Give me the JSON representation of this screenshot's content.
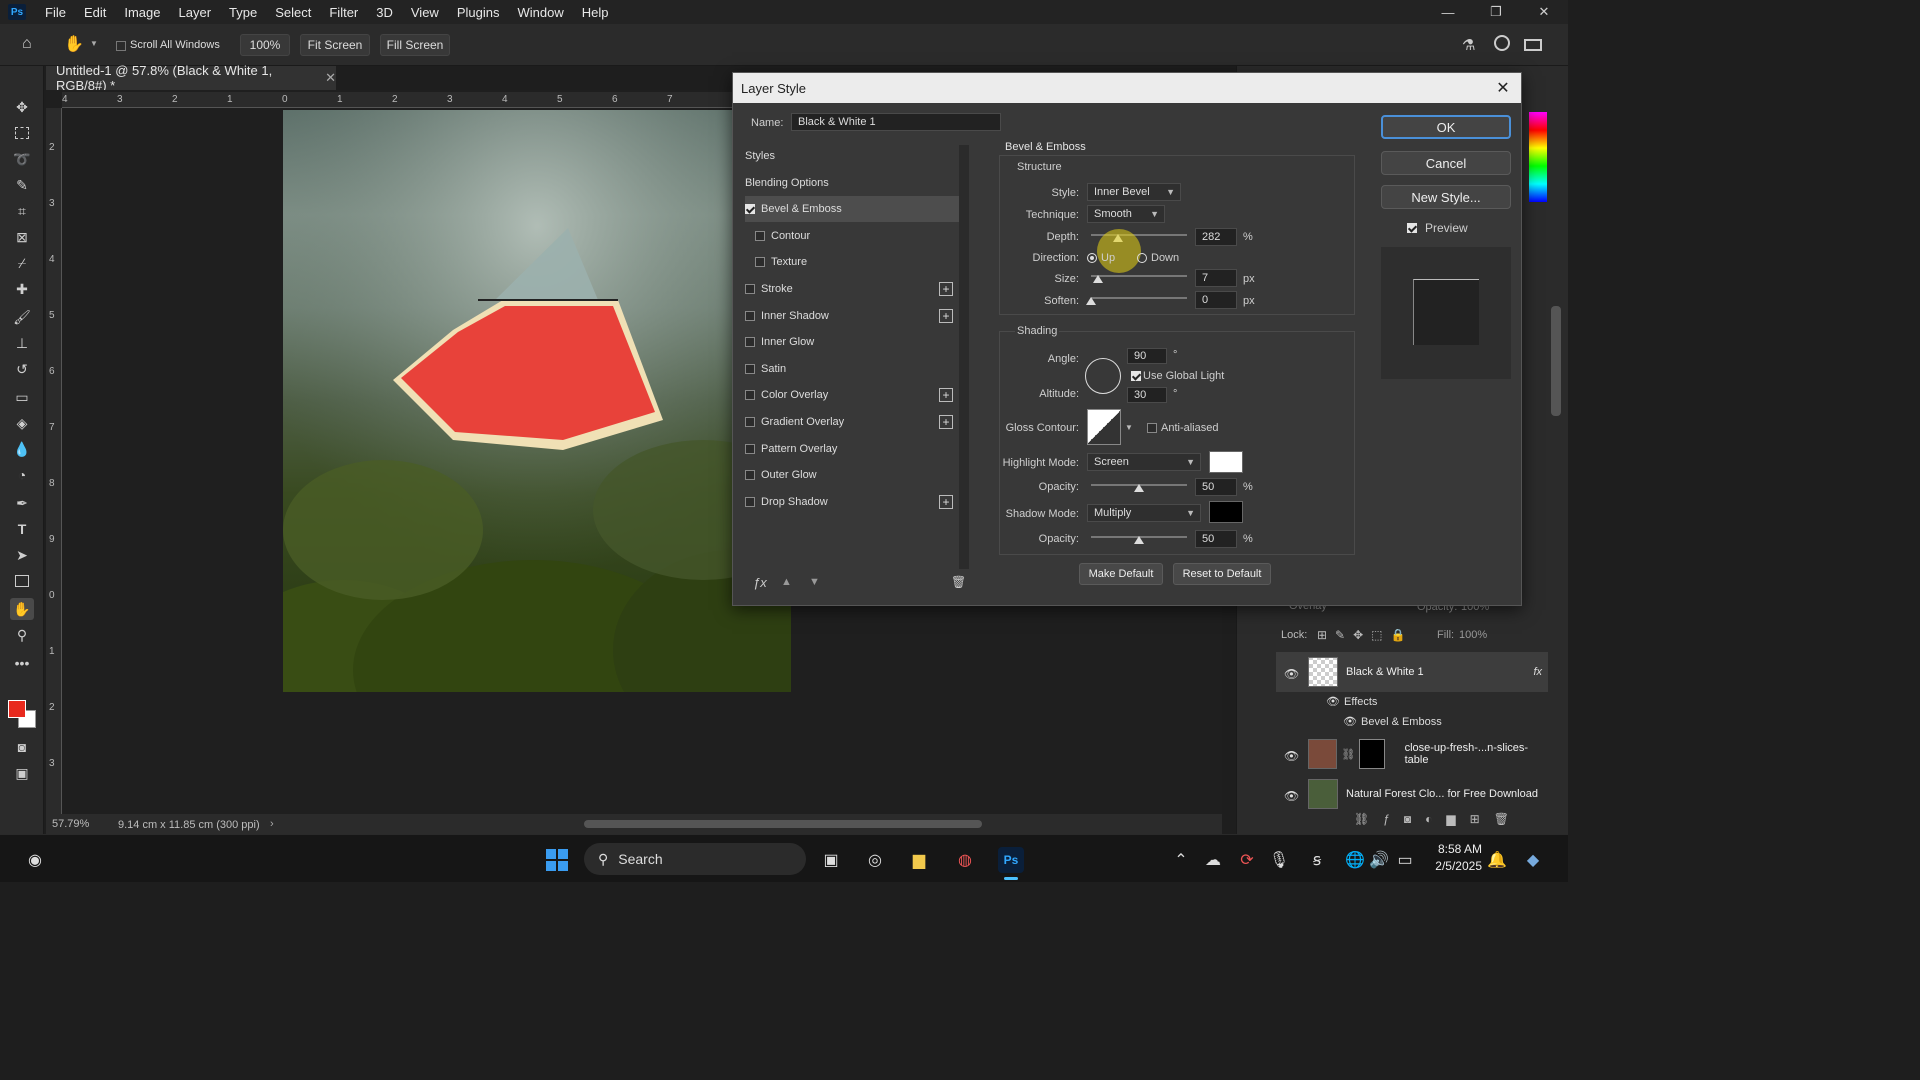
{
  "app": {
    "menu": [
      "File",
      "Edit",
      "Image",
      "Layer",
      "Type",
      "Select",
      "Filter",
      "3D",
      "View",
      "Plugins",
      "Window",
      "Help"
    ],
    "window_controls": [
      "—",
      "❐",
      "✕"
    ]
  },
  "options_bar": {
    "scroll_all_windows": "Scroll All Windows",
    "zoom_value": "100%",
    "fit_screen": "Fit Screen",
    "fill_screen": "Fill Screen"
  },
  "document": {
    "tab_title": "Untitled-1 @ 57.8% (Black & White 1, RGB/8#) *",
    "ruler_h": [
      "4",
      "3",
      "2",
      "1",
      "0",
      "1",
      "2",
      "3",
      "4",
      "5",
      "6",
      "7"
    ],
    "ruler_v": [
      "2",
      "3",
      "4",
      "5",
      "6",
      "7",
      "8",
      "9",
      "0",
      "1",
      "2",
      "3"
    ],
    "zoom": "57.79%",
    "dimensions": "9.14 cm x 11.85 cm (300 ppi)"
  },
  "dialog": {
    "title": "Layer Style",
    "name_label": "Name:",
    "name_value": "Black & White 1",
    "styles_list": [
      {
        "label": "Styles",
        "checkbox": false,
        "checked": false,
        "plus": false,
        "active": false
      },
      {
        "label": "Blending Options",
        "checkbox": false,
        "checked": false,
        "plus": false,
        "active": false
      },
      {
        "label": "Bevel & Emboss",
        "checkbox": true,
        "checked": true,
        "plus": false,
        "active": true
      },
      {
        "label": "Contour",
        "checkbox": true,
        "checked": false,
        "plus": false,
        "active": false,
        "indent": true
      },
      {
        "label": "Texture",
        "checkbox": true,
        "checked": false,
        "plus": false,
        "active": false,
        "indent": true
      },
      {
        "label": "Stroke",
        "checkbox": true,
        "checked": false,
        "plus": true,
        "active": false
      },
      {
        "label": "Inner Shadow",
        "checkbox": true,
        "checked": false,
        "plus": true,
        "active": false
      },
      {
        "label": "Inner Glow",
        "checkbox": true,
        "checked": false,
        "plus": false,
        "active": false
      },
      {
        "label": "Satin",
        "checkbox": true,
        "checked": false,
        "plus": false,
        "active": false
      },
      {
        "label": "Color Overlay",
        "checkbox": true,
        "checked": false,
        "plus": true,
        "active": false
      },
      {
        "label": "Gradient Overlay",
        "checkbox": true,
        "checked": false,
        "plus": true,
        "active": false
      },
      {
        "label": "Pattern Overlay",
        "checkbox": true,
        "checked": false,
        "plus": false,
        "active": false
      },
      {
        "label": "Outer Glow",
        "checkbox": true,
        "checked": false,
        "plus": false,
        "active": false
      },
      {
        "label": "Drop Shadow",
        "checkbox": true,
        "checked": false,
        "plus": true,
        "active": false
      }
    ],
    "section_title": "Bevel & Emboss",
    "structure": {
      "title": "Structure",
      "style_label": "Style:",
      "style_value": "Inner Bevel",
      "technique_label": "Technique:",
      "technique_value": "Smooth",
      "depth_label": "Depth:",
      "depth_value": "282",
      "depth_unit": "%",
      "depth_slider": 0.28,
      "direction_label": "Direction:",
      "direction_up": "Up",
      "direction_down": "Down",
      "size_label": "Size:",
      "size_value": "7",
      "size_unit": "px",
      "size_slider": 0.06,
      "soften_label": "Soften:",
      "soften_value": "0",
      "soften_unit": "px",
      "soften_slider": 0.0
    },
    "shading": {
      "title": "Shading",
      "angle_label": "Angle:",
      "angle_value": "90",
      "angle_unit": "°",
      "use_global_light": "Use Global Light",
      "altitude_label": "Altitude:",
      "altitude_value": "30",
      "altitude_unit": "°",
      "gloss_contour_label": "Gloss Contour:",
      "anti_aliased": "Anti-aliased",
      "highlight_mode_label": "Highlight Mode:",
      "highlight_mode_value": "Screen",
      "highlight_color": "#ffffff",
      "highlight_opacity_label": "Opacity:",
      "highlight_opacity_value": "50",
      "highlight_opacity_unit": "%",
      "highlight_opacity_slider": 0.5,
      "shadow_mode_label": "Shadow Mode:",
      "shadow_mode_value": "Multiply",
      "shadow_color": "#000000",
      "shadow_opacity_label": "Opacity:",
      "shadow_opacity_value": "50",
      "shadow_opacity_unit": "%",
      "shadow_opacity_slider": 0.5
    },
    "make_default": "Make Default",
    "reset_default": "Reset to Default",
    "ok": "OK",
    "cancel": "Cancel",
    "new_style": "New Style...",
    "preview": "Preview"
  },
  "layers_panel": {
    "blend_mode": "Overlay",
    "opacity_label": "Opacity:",
    "opacity_value": "100%",
    "lock_label": "Lock:",
    "fill_label": "Fill:",
    "fill_value": "100%",
    "layers": [
      {
        "name": "Black & White 1",
        "fx": "fx"
      },
      {
        "name": "close-up-fresh-...n-slices-table"
      },
      {
        "name": "Natural Forest Clo... for Free Download"
      }
    ],
    "effects_label": "Effects",
    "effect_item": "Bevel & Emboss"
  },
  "taskbar": {
    "search": "Search",
    "time": "8:58 AM",
    "date": "2/5/2025"
  },
  "colors": {
    "foreground": "#e8291d",
    "background": "#ffffff",
    "accent": "#4a90d9"
  }
}
